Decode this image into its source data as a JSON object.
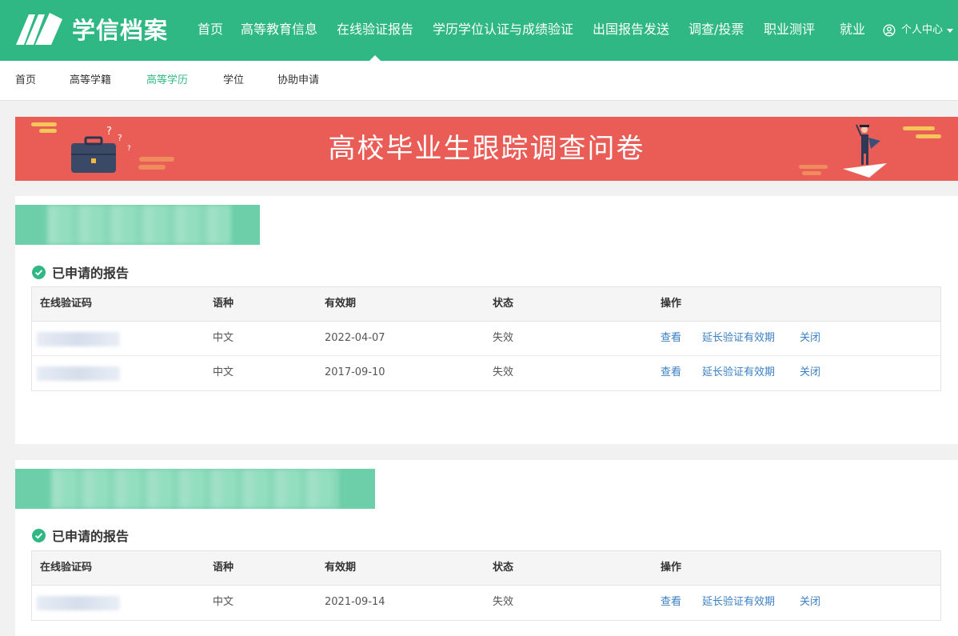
{
  "brand": {
    "name": "学信档案",
    "color": "#2fb883"
  },
  "nav": {
    "items": [
      "首页",
      "高等教育信息",
      "在线验证报告",
      "学历学位认证与成绩验证",
      "出国报告发送",
      "调查/投票",
      "职业测评",
      "就业"
    ],
    "active_index": 2,
    "user_menu": "个人中心"
  },
  "subnav": {
    "items": [
      "首页",
      "高等学籍",
      "高等学历",
      "学位",
      "协助申请"
    ],
    "active_index": 2
  },
  "banner": {
    "title": "高校毕业生跟踪调查问卷",
    "color": "#ea5d57"
  },
  "sections": [
    {
      "title": "已申请的报告",
      "columns": [
        "在线验证码",
        "语种",
        "有效期",
        "状态",
        "操作"
      ],
      "rows": [
        {
          "language": "中文",
          "expiry": "2022-04-07",
          "status": "失效"
        },
        {
          "language": "中文",
          "expiry": "2017-09-10",
          "status": "失效"
        }
      ]
    },
    {
      "title": "已申请的报告",
      "columns": [
        "在线验证码",
        "语种",
        "有效期",
        "状态",
        "操作"
      ],
      "rows": [
        {
          "language": "中文",
          "expiry": "2021-09-14",
          "status": "失效"
        }
      ]
    }
  ],
  "actions": {
    "view": "查看",
    "extend": "延长验证有效期",
    "close": "关闭"
  },
  "icons": {
    "user": "user-circle-icon",
    "check": "check-circle-icon",
    "logo": "book-logo-icon"
  }
}
